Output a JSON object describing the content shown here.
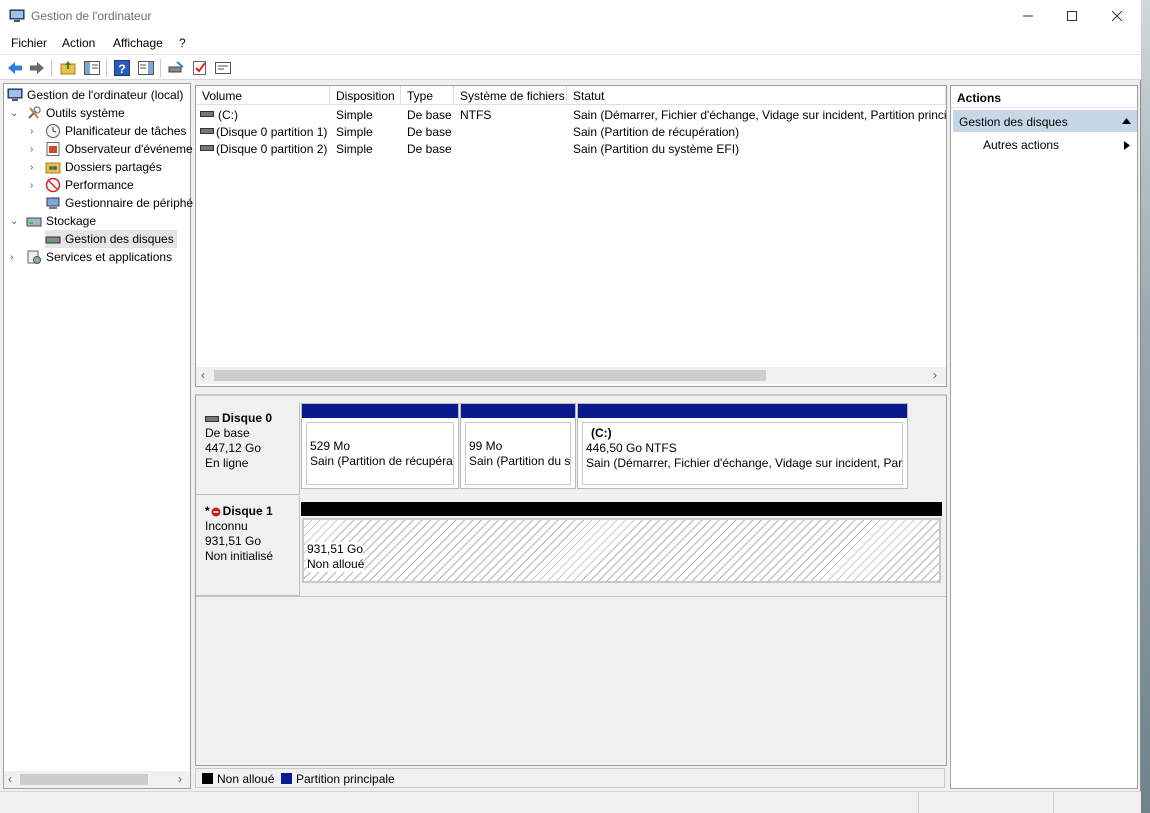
{
  "window": {
    "title": "Gestion de l'ordinateur"
  },
  "menu": [
    "Fichier",
    "Action",
    "Affichage",
    "?"
  ],
  "tree": {
    "root": "Gestion de l'ordinateur (local)",
    "system_tools": "Outils système",
    "task_scheduler": "Planificateur de tâches",
    "event_viewer": "Observateur d'événeme",
    "shared_folders": "Dossiers partagés",
    "performance": "Performance",
    "device_manager": "Gestionnaire de périphé",
    "storage": "Stockage",
    "disk_management": "Gestion des disques",
    "services": "Services et applications"
  },
  "volumes": {
    "headers": [
      "Volume",
      "Disposition",
      "Type",
      "Système de fichiers",
      "Statut"
    ],
    "rows": [
      [
        "(C:)",
        "Simple",
        "De base",
        "NTFS",
        "Sain (Démarrer, Fichier d'échange, Vidage sur incident, Partition princip"
      ],
      [
        "(Disque 0 partition 1)",
        "Simple",
        "De base",
        "",
        "Sain (Partition de récupération)"
      ],
      [
        "(Disque 0 partition 2)",
        "Simple",
        "De base",
        "",
        "Sain (Partition du système EFI)"
      ]
    ]
  },
  "disks": [
    {
      "name": "Disque 0",
      "type": "De base",
      "size": "447,12 Go",
      "state": "En ligne",
      "partitions": [
        {
          "title": "",
          "size": "529 Mo",
          "status": "Sain (Partition de récupérat"
        },
        {
          "title": "",
          "size": "99 Mo",
          "status": "Sain (Partition du sy"
        },
        {
          "title": "(C:)",
          "size": "446,50 Go NTFS",
          "status": "Sain (Démarrer, Fichier d'échange, Vidage sur incident, Partit"
        }
      ]
    },
    {
      "name": "Disque 1",
      "prefix": "*",
      "type": "Inconnu",
      "size": "931,51 Go",
      "state": "Non initialisé",
      "partitions": [
        {
          "size": "931,51 Go",
          "status": "Non alloué"
        }
      ]
    }
  ],
  "legend": {
    "unallocated": "Non alloué",
    "primary": "Partition principale"
  },
  "actions": {
    "header": "Actions",
    "section": "Gestion des disques",
    "more": "Autres actions"
  },
  "colors": {
    "primary_partition": "#0a1a8c",
    "unallocated": "#000000",
    "selection": "#c7d7e8"
  }
}
